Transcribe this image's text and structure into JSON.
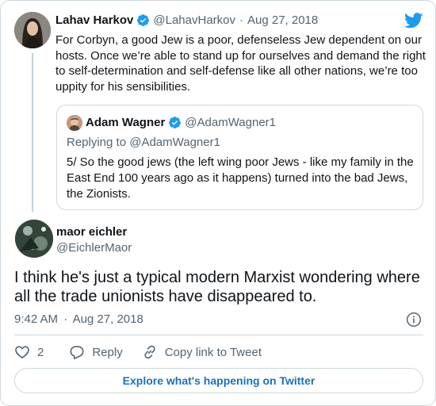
{
  "original_tweet": {
    "name": "Lahav Harkov",
    "handle": "@LahavHarkov",
    "separator": "·",
    "date": "Aug 27, 2018",
    "text": "For Corbyn, a good Jew is a poor, defenseless Jew dependent on our hosts. Once we’re able to stand up for ourselves and demand the right to self-determination and self-defense like all other nations, we’re too uppity for his sensibilities."
  },
  "quoted_tweet": {
    "name": "Adam Wagner",
    "handle": "@AdamWagner1",
    "replying_to": "Replying to @AdamWagner1",
    "text": "5/ So the good jews (the left wing poor Jews - like my family in the East End 100 years ago as it happens) turned into the bad Jews, the Zionists."
  },
  "reply_tweet": {
    "name": "maor eichler",
    "handle": "@EichlerMaor",
    "text": "I think he's just a typical modern Marxist wondering where all the trade unionists have disappeared to.",
    "time": "9:42 AM",
    "separator": "·",
    "date": "Aug 27, 2018"
  },
  "actions": {
    "like_count": "2",
    "reply_label": "Reply",
    "copy_link_label": "Copy link to Tweet"
  },
  "explore_label": "Explore what's happening on Twitter",
  "colors": {
    "twitter_blue": "#1d9bf0",
    "link_blue": "#1d70b8",
    "muted": "#536471",
    "border": "#cfd9de"
  },
  "icons": [
    "twitter-bird-icon",
    "verified-badge-icon",
    "info-icon",
    "heart-icon",
    "reply-bubble-icon",
    "link-icon"
  ]
}
